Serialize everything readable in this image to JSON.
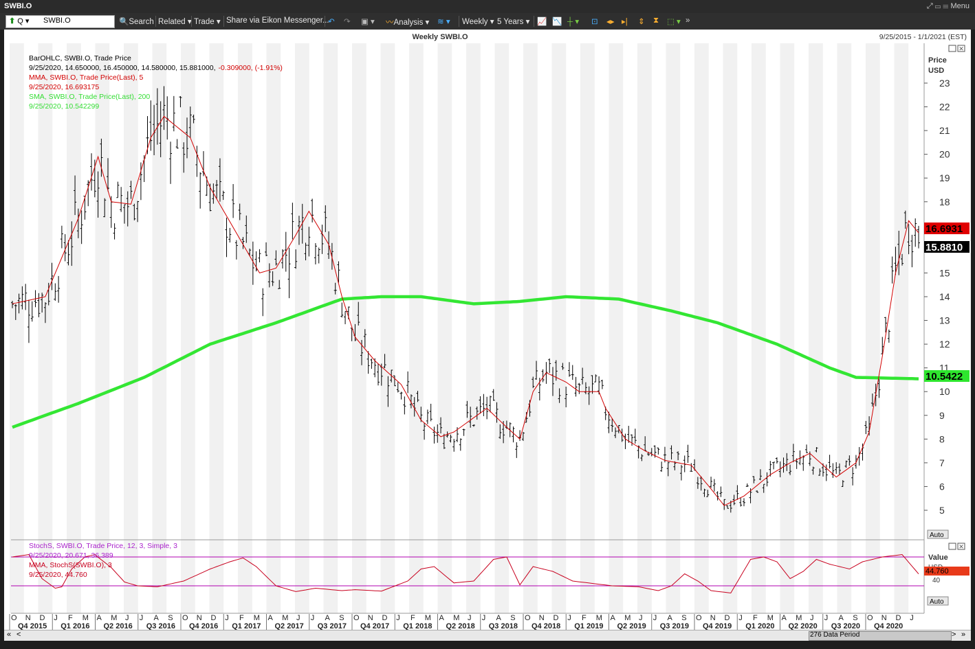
{
  "window": {
    "title": "SWBI.O",
    "menu_label": "Menu"
  },
  "toolbar": {
    "ric_prefix": "Q",
    "ric_value": "SWBI.O",
    "search": "Search",
    "related": "Related",
    "trade": "Trade",
    "share": "Share via Eikon Messenger...",
    "analysis": "Analysis",
    "interval": "Weekly",
    "period": "5 Years"
  },
  "chart": {
    "title": "Weekly SWBI.O",
    "date_range": "9/25/2015 - 1/1/2021 (EST)",
    "price_axis_title": "Price",
    "price_axis_unit": "USD",
    "auto_label": "Auto",
    "legend": {
      "line1": "BarOHLC, SWBI.O, Trade Price",
      "line2_values": "9/25/2020, 14.650000, 16.450000, 14.580000, 15.881000,",
      "line2_change": "-0.309000, (-1.91%)",
      "mma_label": "MMA, SWBI.O, Trade Price(Last),  5",
      "mma_value": "9/25/2020, 16.693175",
      "sma_label": "SMA, SWBI.O, Trade Price(Last),  200",
      "sma_value": "9/25/2020, 10.542299"
    },
    "price_tags": {
      "mma": "16.6931",
      "last": "15.8810",
      "sma": "10.5422"
    },
    "stoch_legend": {
      "label": "StochS, SWBI.O, Trade Price,  12, 3, Simple, 3",
      "values": "9/25/2020, 20.671, 36.389",
      "mma_label": "MMA, StochS(SWBI.O),  3",
      "mma_value": "9/25/2020, 44.760"
    },
    "stoch_axis": {
      "title": "Value",
      "unit": "USD",
      "tick_40": "40",
      "tag": "44.760"
    },
    "footer_periods": "276 Data Period"
  },
  "colors": {
    "price_bar": "#000000",
    "mma": "#d20000",
    "sma": "#33e633",
    "stoch": "#c8001e",
    "stoch_band": "#b000b0",
    "legend_stoch": "#aa22cc"
  },
  "chart_data": {
    "type": "bar",
    "price_axis": {
      "ticks": [
        "5",
        "6",
        "7",
        "8",
        "9",
        "10",
        "11",
        "12",
        "13",
        "14",
        "15",
        "16",
        "17",
        "18",
        "19",
        "20",
        "21",
        "22",
        "23"
      ],
      "ylim": [
        4.0,
        24.0
      ]
    },
    "x_month_labels": [
      "O",
      "N",
      "D",
      "J",
      "F",
      "M",
      "A",
      "M",
      "J",
      "J",
      "A",
      "S",
      "O",
      "N",
      "D",
      "J",
      "F",
      "M",
      "A",
      "M",
      "J",
      "J",
      "A",
      "S",
      "O",
      "N",
      "D",
      "J",
      "F",
      "M",
      "A",
      "M",
      "J",
      "J",
      "A",
      "S",
      "O",
      "N",
      "D",
      "J",
      "F",
      "M",
      "A",
      "M",
      "J",
      "J",
      "A",
      "S",
      "O",
      "N",
      "D",
      "J",
      "F",
      "M",
      "A",
      "M",
      "J",
      "J",
      "A",
      "S",
      "O",
      "N",
      "D",
      "J"
    ],
    "x_quarter_labels": [
      "Q4 2015",
      "Q1 2016",
      "Q2 2016",
      "Q3 2016",
      "Q4 2016",
      "Q1 2017",
      "Q2 2017",
      "Q3 2017",
      "Q4 2017",
      "Q1 2018",
      "Q2 2018",
      "Q3 2018",
      "Q4 2018",
      "Q1 2019",
      "Q2 2019",
      "Q3 2019",
      "Q4 2019",
      "Q1 2020",
      "Q2 2020",
      "Q3 2020",
      "Q4 2020"
    ],
    "series": [
      {
        "name": "MMA, SWBI.O, Trade Price(Last), 5",
        "points": [
          [
            0,
            13.7
          ],
          [
            10,
            14.0
          ],
          [
            20,
            17.3
          ],
          [
            26,
            19.9
          ],
          [
            30,
            18.0
          ],
          [
            36,
            17.9
          ],
          [
            42,
            20.7
          ],
          [
            46,
            21.6
          ],
          [
            54,
            20.7
          ],
          [
            60,
            18.6
          ],
          [
            70,
            16.2
          ],
          [
            75,
            15.0
          ],
          [
            80,
            15.2
          ],
          [
            86,
            16.6
          ],
          [
            90,
            17.6
          ],
          [
            96,
            16.2
          ],
          [
            100,
            14.0
          ],
          [
            104,
            12.3
          ],
          [
            110,
            11.3
          ],
          [
            118,
            10.3
          ],
          [
            124,
            8.8
          ],
          [
            130,
            8.1
          ],
          [
            134,
            8.3
          ],
          [
            140,
            8.9
          ],
          [
            144,
            9.3
          ],
          [
            150,
            8.5
          ],
          [
            154,
            8.0
          ],
          [
            158,
            10.0
          ],
          [
            162,
            10.8
          ],
          [
            168,
            10.4
          ],
          [
            172,
            10.0
          ],
          [
            178,
            10.0
          ],
          [
            180,
            9.3
          ],
          [
            186,
            8.0
          ],
          [
            192,
            7.5
          ],
          [
            198,
            7.1
          ],
          [
            206,
            6.9
          ],
          [
            212,
            5.9
          ],
          [
            216,
            5.2
          ],
          [
            222,
            5.6
          ],
          [
            230,
            6.5
          ],
          [
            236,
            7.0
          ],
          [
            242,
            7.4
          ],
          [
            246,
            6.9
          ],
          [
            250,
            6.4
          ],
          [
            256,
            7.0
          ],
          [
            260,
            8.3
          ],
          [
            264,
            11.5
          ],
          [
            268,
            15.0
          ],
          [
            272,
            17.2
          ],
          [
            275,
            16.69
          ]
        ]
      },
      {
        "name": "SMA, SWBI.O, Trade Price(Last), 200",
        "points": [
          [
            0,
            8.5
          ],
          [
            20,
            9.5
          ],
          [
            40,
            10.6
          ],
          [
            60,
            12.0
          ],
          [
            80,
            12.9
          ],
          [
            100,
            13.9
          ],
          [
            112,
            14.0
          ],
          [
            124,
            14.0
          ],
          [
            140,
            13.7
          ],
          [
            154,
            13.8
          ],
          [
            168,
            14.0
          ],
          [
            184,
            13.9
          ],
          [
            200,
            13.4
          ],
          [
            214,
            12.9
          ],
          [
            232,
            12.0
          ],
          [
            248,
            11.0
          ],
          [
            256,
            10.6
          ],
          [
            275,
            10.54
          ]
        ]
      }
    ],
    "ohlc_last": {
      "date": "9/25/2020",
      "open": 14.65,
      "high": 16.45,
      "low": 14.58,
      "close": 15.881,
      "change": -0.309,
      "change_pct": -1.91
    },
    "stochastic": {
      "ylim": [
        0,
        100
      ],
      "band_levels": [
        80,
        20
      ],
      "mma_points": [
        [
          0,
          80
        ],
        [
          5,
          85
        ],
        [
          9,
          35
        ],
        [
          13,
          15
        ],
        [
          15,
          18
        ],
        [
          18,
          55
        ],
        [
          22,
          80
        ],
        [
          25,
          85
        ],
        [
          30,
          58
        ],
        [
          34,
          28
        ],
        [
          38,
          20
        ],
        [
          44,
          18
        ],
        [
          52,
          30
        ],
        [
          60,
          55
        ],
        [
          66,
          70
        ],
        [
          70,
          78
        ],
        [
          74,
          60
        ],
        [
          80,
          20
        ],
        [
          86,
          8
        ],
        [
          92,
          15
        ],
        [
          100,
          10
        ],
        [
          104,
          12
        ],
        [
          112,
          9
        ],
        [
          120,
          30
        ],
        [
          124,
          55
        ],
        [
          128,
          60
        ],
        [
          134,
          26
        ],
        [
          140,
          30
        ],
        [
          146,
          75
        ],
        [
          150,
          80
        ],
        [
          154,
          22
        ],
        [
          158,
          60
        ],
        [
          164,
          50
        ],
        [
          170,
          30
        ],
        [
          176,
          25
        ],
        [
          182,
          20
        ],
        [
          190,
          18
        ],
        [
          196,
          10
        ],
        [
          200,
          20
        ],
        [
          204,
          45
        ],
        [
          208,
          30
        ],
        [
          212,
          10
        ],
        [
          218,
          5
        ],
        [
          224,
          75
        ],
        [
          228,
          80
        ],
        [
          232,
          70
        ],
        [
          236,
          35
        ],
        [
          240,
          50
        ],
        [
          244,
          75
        ],
        [
          248,
          65
        ],
        [
          254,
          55
        ],
        [
          258,
          70
        ],
        [
          264,
          80
        ],
        [
          270,
          85
        ],
        [
          275,
          44.76
        ]
      ]
    }
  }
}
